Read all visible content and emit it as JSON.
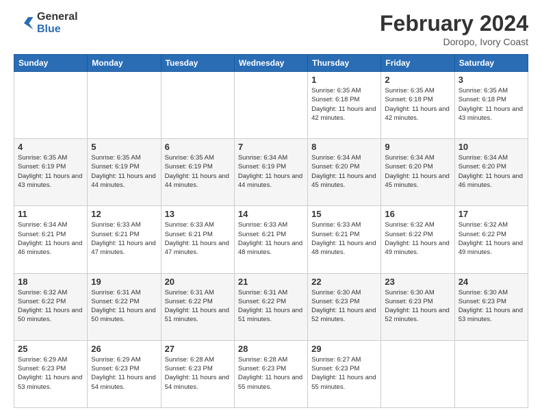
{
  "logo": {
    "general": "General",
    "blue": "Blue"
  },
  "header": {
    "title": "February 2024",
    "location": "Doropo, Ivory Coast"
  },
  "weekdays": [
    "Sunday",
    "Monday",
    "Tuesday",
    "Wednesday",
    "Thursday",
    "Friday",
    "Saturday"
  ],
  "weeks": [
    [
      {
        "day": "",
        "info": ""
      },
      {
        "day": "",
        "info": ""
      },
      {
        "day": "",
        "info": ""
      },
      {
        "day": "",
        "info": ""
      },
      {
        "day": "1",
        "info": "Sunrise: 6:35 AM\nSunset: 6:18 PM\nDaylight: 11 hours and 42 minutes."
      },
      {
        "day": "2",
        "info": "Sunrise: 6:35 AM\nSunset: 6:18 PM\nDaylight: 11 hours and 42 minutes."
      },
      {
        "day": "3",
        "info": "Sunrise: 6:35 AM\nSunset: 6:18 PM\nDaylight: 11 hours and 43 minutes."
      }
    ],
    [
      {
        "day": "4",
        "info": "Sunrise: 6:35 AM\nSunset: 6:19 PM\nDaylight: 11 hours and 43 minutes."
      },
      {
        "day": "5",
        "info": "Sunrise: 6:35 AM\nSunset: 6:19 PM\nDaylight: 11 hours and 44 minutes."
      },
      {
        "day": "6",
        "info": "Sunrise: 6:35 AM\nSunset: 6:19 PM\nDaylight: 11 hours and 44 minutes."
      },
      {
        "day": "7",
        "info": "Sunrise: 6:34 AM\nSunset: 6:19 PM\nDaylight: 11 hours and 44 minutes."
      },
      {
        "day": "8",
        "info": "Sunrise: 6:34 AM\nSunset: 6:20 PM\nDaylight: 11 hours and 45 minutes."
      },
      {
        "day": "9",
        "info": "Sunrise: 6:34 AM\nSunset: 6:20 PM\nDaylight: 11 hours and 45 minutes."
      },
      {
        "day": "10",
        "info": "Sunrise: 6:34 AM\nSunset: 6:20 PM\nDaylight: 11 hours and 46 minutes."
      }
    ],
    [
      {
        "day": "11",
        "info": "Sunrise: 6:34 AM\nSunset: 6:21 PM\nDaylight: 11 hours and 46 minutes."
      },
      {
        "day": "12",
        "info": "Sunrise: 6:33 AM\nSunset: 6:21 PM\nDaylight: 11 hours and 47 minutes."
      },
      {
        "day": "13",
        "info": "Sunrise: 6:33 AM\nSunset: 6:21 PM\nDaylight: 11 hours and 47 minutes."
      },
      {
        "day": "14",
        "info": "Sunrise: 6:33 AM\nSunset: 6:21 PM\nDaylight: 11 hours and 48 minutes."
      },
      {
        "day": "15",
        "info": "Sunrise: 6:33 AM\nSunset: 6:21 PM\nDaylight: 11 hours and 48 minutes."
      },
      {
        "day": "16",
        "info": "Sunrise: 6:32 AM\nSunset: 6:22 PM\nDaylight: 11 hours and 49 minutes."
      },
      {
        "day": "17",
        "info": "Sunrise: 6:32 AM\nSunset: 6:22 PM\nDaylight: 11 hours and 49 minutes."
      }
    ],
    [
      {
        "day": "18",
        "info": "Sunrise: 6:32 AM\nSunset: 6:22 PM\nDaylight: 11 hours and 50 minutes."
      },
      {
        "day": "19",
        "info": "Sunrise: 6:31 AM\nSunset: 6:22 PM\nDaylight: 11 hours and 50 minutes."
      },
      {
        "day": "20",
        "info": "Sunrise: 6:31 AM\nSunset: 6:22 PM\nDaylight: 11 hours and 51 minutes."
      },
      {
        "day": "21",
        "info": "Sunrise: 6:31 AM\nSunset: 6:22 PM\nDaylight: 11 hours and 51 minutes."
      },
      {
        "day": "22",
        "info": "Sunrise: 6:30 AM\nSunset: 6:23 PM\nDaylight: 11 hours and 52 minutes."
      },
      {
        "day": "23",
        "info": "Sunrise: 6:30 AM\nSunset: 6:23 PM\nDaylight: 11 hours and 52 minutes."
      },
      {
        "day": "24",
        "info": "Sunrise: 6:30 AM\nSunset: 6:23 PM\nDaylight: 11 hours and 53 minutes."
      }
    ],
    [
      {
        "day": "25",
        "info": "Sunrise: 6:29 AM\nSunset: 6:23 PM\nDaylight: 11 hours and 53 minutes."
      },
      {
        "day": "26",
        "info": "Sunrise: 6:29 AM\nSunset: 6:23 PM\nDaylight: 11 hours and 54 minutes."
      },
      {
        "day": "27",
        "info": "Sunrise: 6:28 AM\nSunset: 6:23 PM\nDaylight: 11 hours and 54 minutes."
      },
      {
        "day": "28",
        "info": "Sunrise: 6:28 AM\nSunset: 6:23 PM\nDaylight: 11 hours and 55 minutes."
      },
      {
        "day": "29",
        "info": "Sunrise: 6:27 AM\nSunset: 6:23 PM\nDaylight: 11 hours and 55 minutes."
      },
      {
        "day": "",
        "info": ""
      },
      {
        "day": "",
        "info": ""
      }
    ]
  ]
}
